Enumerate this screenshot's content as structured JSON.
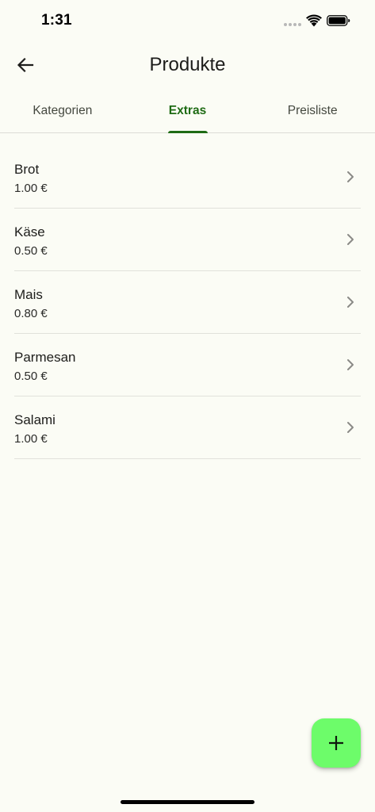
{
  "status_bar": {
    "time": "1:31"
  },
  "app_bar": {
    "title": "Produkte",
    "back_icon": "arrow-left-icon"
  },
  "tabs": [
    {
      "label": "Kategorien",
      "active": false
    },
    {
      "label": "Extras",
      "active": true
    },
    {
      "label": "Preisliste",
      "active": false
    }
  ],
  "extras": [
    {
      "name": "Brot",
      "price": "1.00 €"
    },
    {
      "name": "Käse",
      "price": "0.50 €"
    },
    {
      "name": "Mais",
      "price": "0.80 €"
    },
    {
      "name": "Parmesan",
      "price": "0.50 €"
    },
    {
      "name": "Salami",
      "price": "1.00 €"
    }
  ],
  "fab": {
    "icon": "plus-icon"
  },
  "colors": {
    "background": "#fbfcf5",
    "accent": "#1e6b14",
    "fab": "#6dfc6a",
    "divider": "#e1e1db"
  }
}
